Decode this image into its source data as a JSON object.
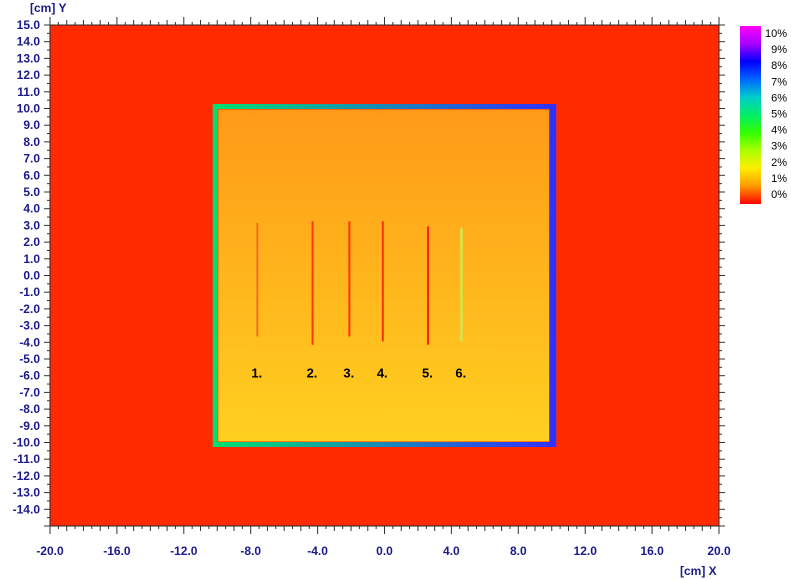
{
  "chart_data": {
    "type": "heatmap",
    "x_axis": {
      "label": "[cm] X",
      "range": [
        -20,
        20
      ],
      "ticks": [
        "-20.0",
        "-16.0",
        "-12.0",
        "-8.0",
        "-4.0",
        "0.0",
        "4.0",
        "8.0",
        "12.0",
        "16.0",
        "20.0"
      ]
    },
    "y_axis": {
      "label": "[cm] Y",
      "range": [
        -15,
        15
      ],
      "ticks": [
        "15.0",
        "14.0",
        "13.0",
        "12.0",
        "11.0",
        "10.0",
        "9.0",
        "8.0",
        "7.0",
        "6.0",
        "5.0",
        "4.0",
        "3.0",
        "2.0",
        "1.0",
        "0.0",
        "-1.0",
        "-2.0",
        "-3.0",
        "-4.0",
        "-5.0",
        "-6.0",
        "-7.0",
        "-8.0",
        "-9.0",
        "-10.0",
        "-11.0",
        "-12.0",
        "-13.0",
        "-14.0"
      ]
    },
    "colorbar": {
      "labels": [
        "10%",
        "9%",
        "8%",
        "7%",
        "6%",
        "5%",
        "4%",
        "3%",
        "2%",
        "1%",
        "0%"
      ],
      "colors": [
        "#ff00ff",
        "#aa00ff",
        "#0000ff",
        "#0066ff",
        "#00cccc",
        "#00ee66",
        "#33ff00",
        "#aaff00",
        "#ffee00",
        "#ff9900",
        "#ff0000"
      ]
    },
    "field": {
      "x": [
        -10,
        10
      ],
      "y": [
        -10,
        10
      ]
    },
    "markers": [
      {
        "label": "1.",
        "x": -7.6,
        "y_top": 3.1,
        "y_bottom": -3.6,
        "color": "#f07020"
      },
      {
        "label": "2.",
        "x": -4.3,
        "y_top": 3.2,
        "y_bottom": -4.1,
        "color": "#ff3a00"
      },
      {
        "label": "3.",
        "x": -2.1,
        "y_top": 3.2,
        "y_bottom": -3.6,
        "color": "#ff3300"
      },
      {
        "label": "4.",
        "x": -0.1,
        "y_top": 3.2,
        "y_bottom": -3.9,
        "color": "#ff3300"
      },
      {
        "label": "5.",
        "x": 2.6,
        "y_top": 2.9,
        "y_bottom": -4.1,
        "color": "#ff2200"
      },
      {
        "label": "6.",
        "x": 4.6,
        "y_top": 2.8,
        "y_bottom": -3.9,
        "color": "#dddd44"
      }
    ],
    "background_color": "#ff2a00",
    "field_top_color": "#ff9a18",
    "field_bottom_color": "#ffd020"
  }
}
